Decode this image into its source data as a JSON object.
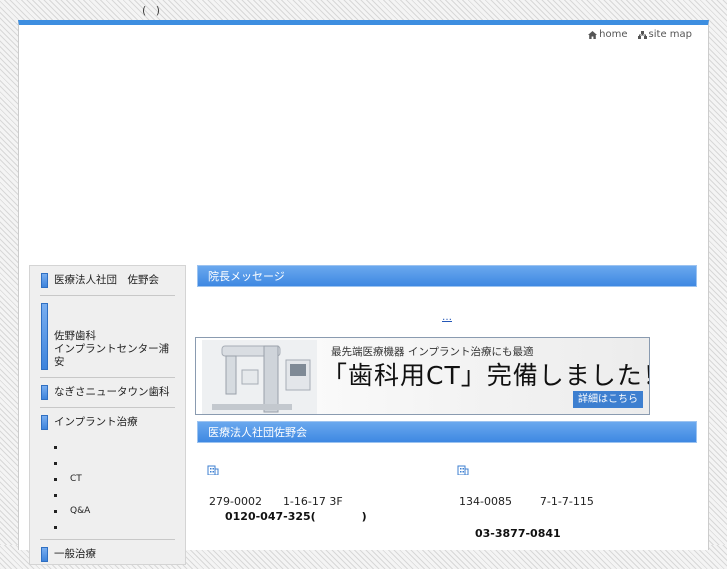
{
  "header": {
    "tag": "( )"
  },
  "util": {
    "home": "home",
    "sitemap": "site map"
  },
  "sidebar": {
    "items": [
      {
        "label": "医療法人社団　佐野会"
      },
      {
        "label": "佐野歯科\nインプラントセンター浦安"
      },
      {
        "label": "なぎさニュータウン歯科"
      },
      {
        "label": "インプラント治療"
      }
    ],
    "sub": [
      "",
      "",
      "CT",
      "",
      "Q&A",
      ""
    ],
    "items2": [
      {
        "label": "一般治療"
      }
    ]
  },
  "main": {
    "message_title": "院長メッセージ",
    "message_link": "…",
    "banner": {
      "top": "最先端医療機器 インプラント治療にも最適",
      "main": "「歯科用CT」完備しました！",
      "button": "詳細はこちら"
    },
    "group_title": "医療法人社団佐野会",
    "clinics": [
      {
        "addr": "279-0002      1-16-17 3F",
        "tel": "0120-047-325(            )"
      },
      {
        "addr": "134-0085        7-1-7-115",
        "tel": "03-3877-0841"
      }
    ]
  },
  "colors": {
    "accent": "#3d8ee0",
    "header_bar": "#4a8fe4"
  }
}
